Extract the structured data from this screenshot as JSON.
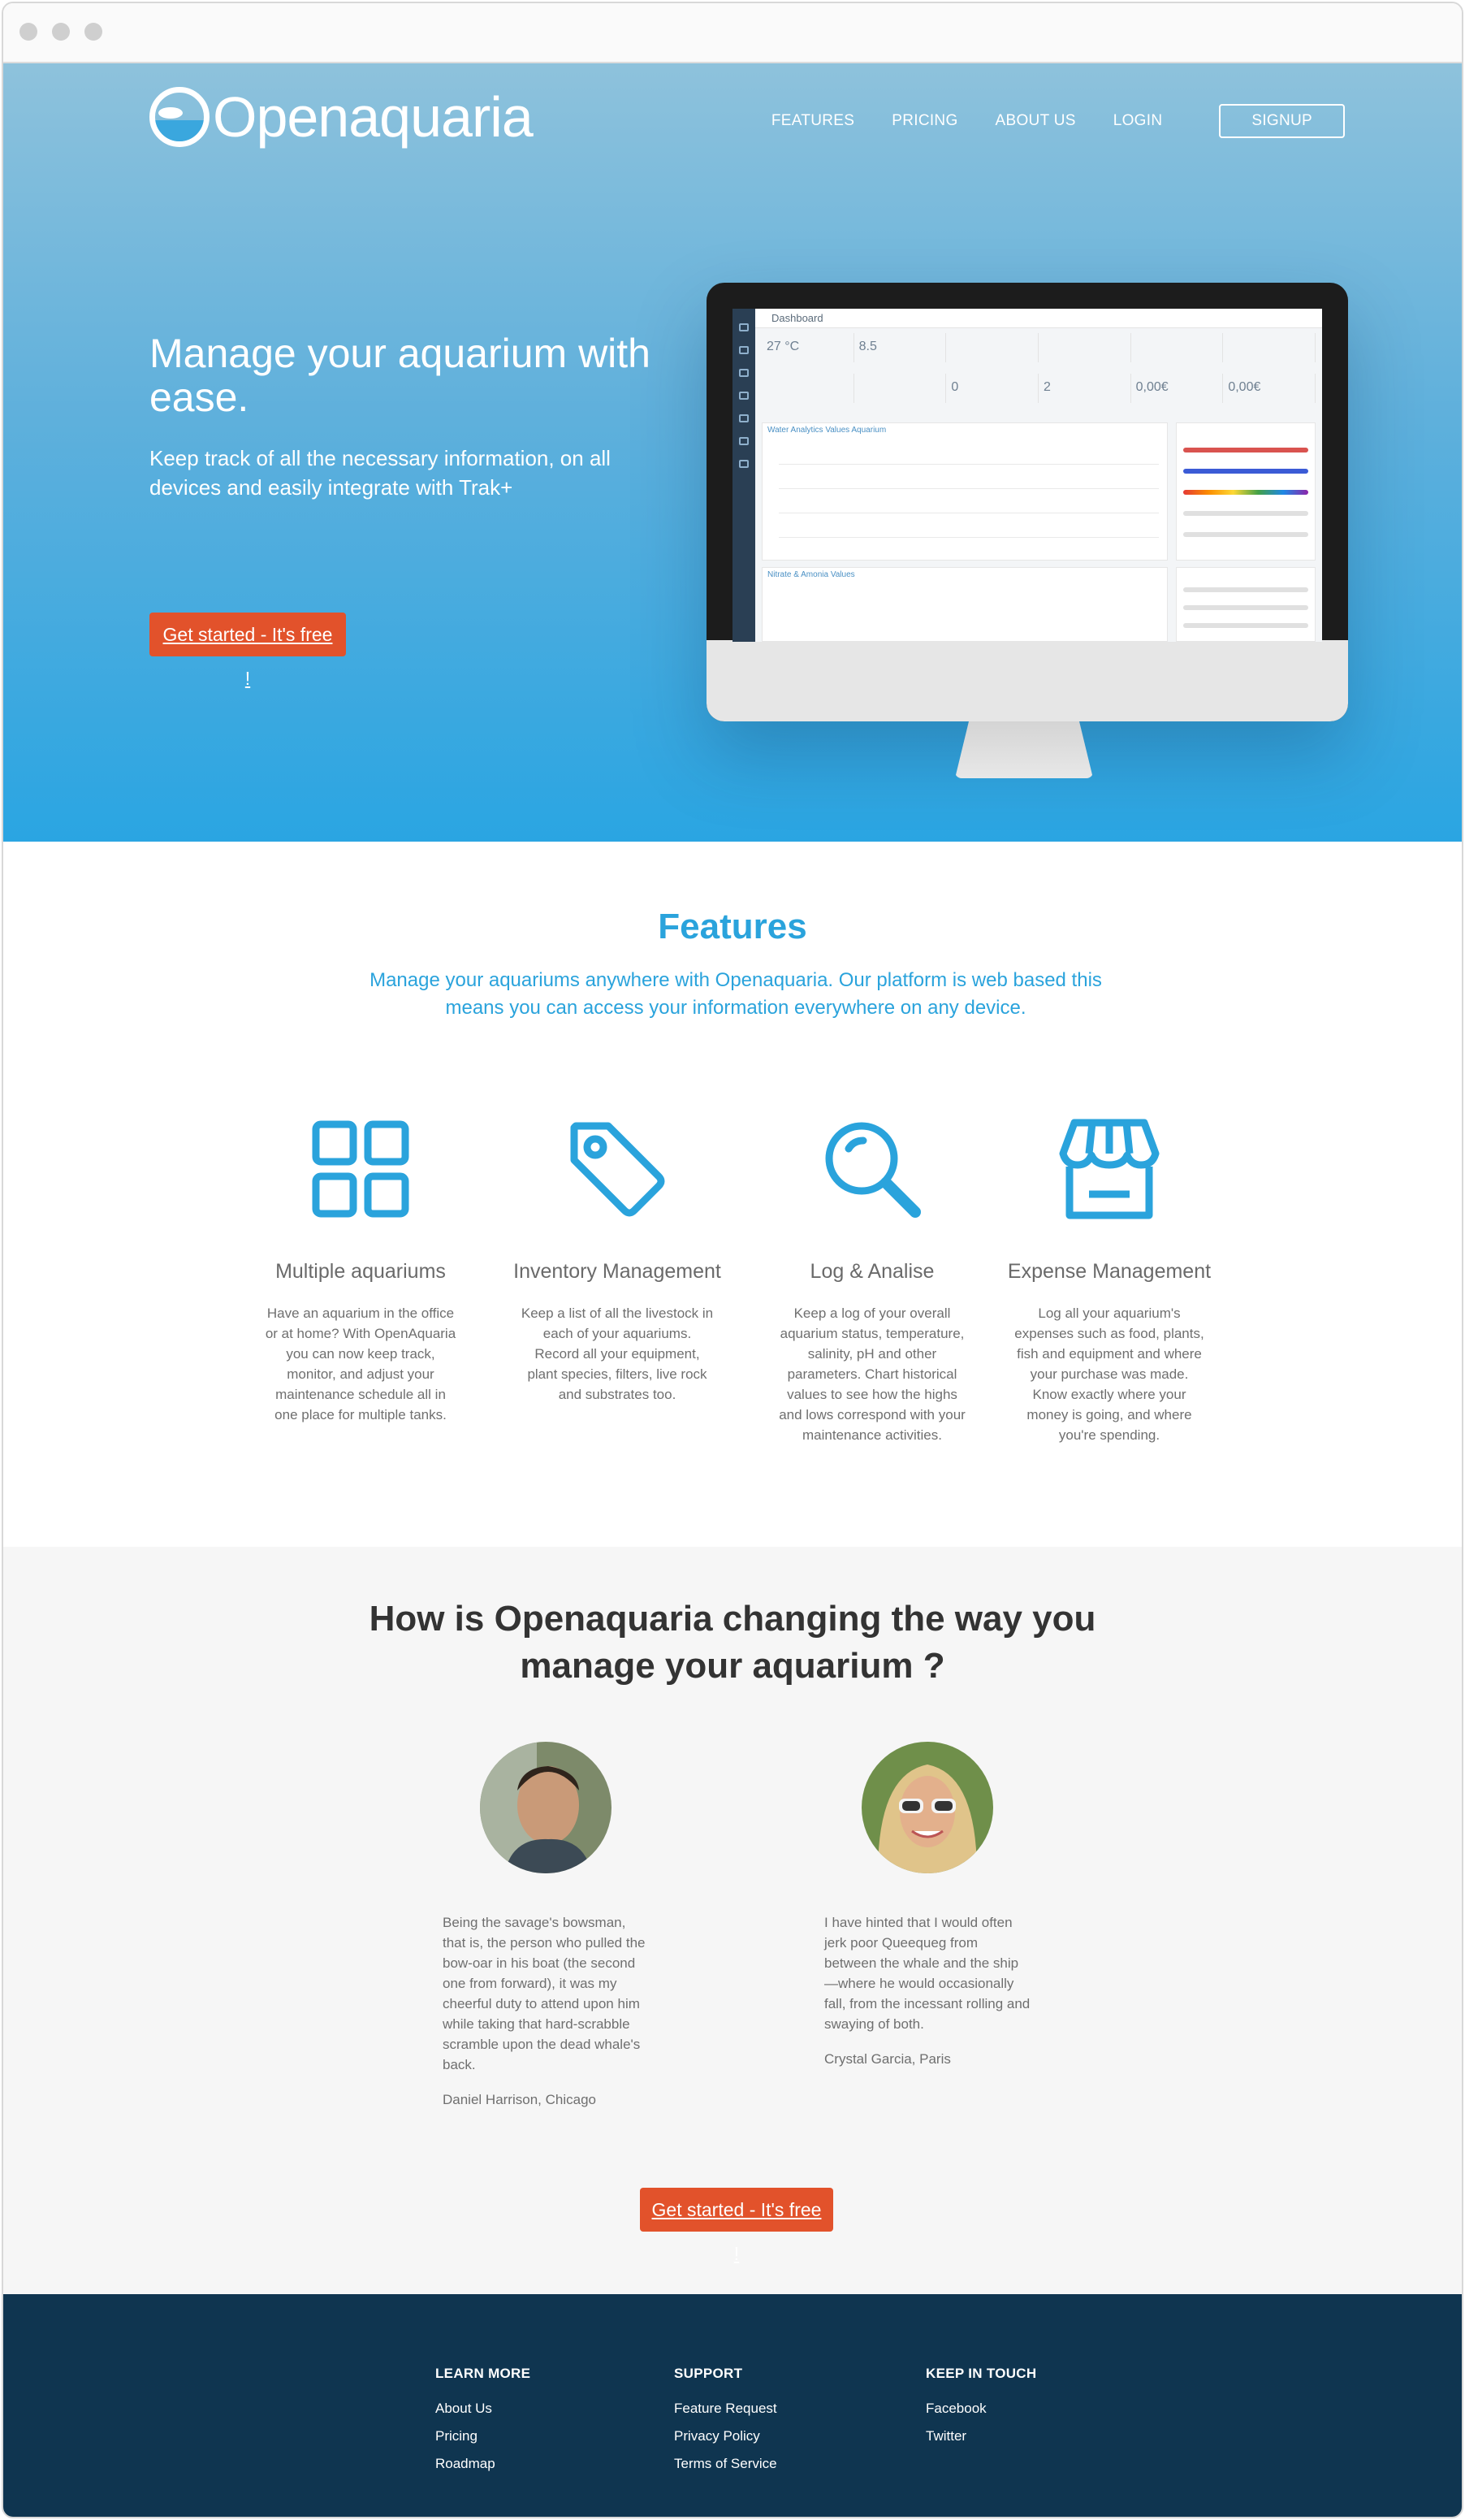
{
  "brand": {
    "name": "Openaquaria"
  },
  "nav": {
    "features": "FEATURES",
    "pricing": "PRICING",
    "about": "ABOUT US",
    "login": "LOGIN",
    "signup": "SIGNUP"
  },
  "hero": {
    "title": "Manage your aquarium with ease.",
    "subtitle": "Keep track of all the necessary information, on all devices and easily integrate with Trak+",
    "cta": "Get started - It's free !"
  },
  "dashboard": {
    "title": "Dashboard",
    "stats": [
      "27 °C",
      "8.5",
      "",
      "",
      "",
      "",
      "",
      "",
      "0",
      "2",
      "0,00€",
      "0,00€"
    ],
    "panel1": "Water Analytics Values Aquarium",
    "panel2": "Nitrate & Amonia Values"
  },
  "features": {
    "title": "Features",
    "subtitle": "Manage your aquariums anywhere with Openaquaria. Our platform is web based this means you can access your information everywhere on any device.",
    "items": [
      {
        "title": "Multiple aquariums",
        "text": "Have an aquarium in the office or at home? With OpenAquaria you can now keep track, monitor, and adjust your maintenance schedule all in one place for multiple tanks.",
        "icon": "grid-icon"
      },
      {
        "title": "Inventory Management",
        "text": "Keep a list of all the livestock in each of your aquariums. Record all your equipment, plant species, filters, live rock and substrates too.",
        "icon": "tag-icon"
      },
      {
        "title": "Log & Analise",
        "text": "Keep a log of your overall aquarium status, temperature, salinity, pH and other parameters. Chart historical values to see how the highs and lows correspond with your maintenance activities.",
        "icon": "magnifier-icon"
      },
      {
        "title": "Expense Management",
        "text": "Log all your aquarium's expenses such as food, plants, fish and equipment and where your purchase was made. Know exactly where your money is going, and where you're spending.",
        "icon": "store-icon"
      }
    ]
  },
  "testimonials": {
    "title": "How is Openaquaria changing the way you manage your aquarium ?",
    "items": [
      {
        "quote": "Being the savage's bowsman, that is, the person who pulled the bow-oar in his boat (the second one from forward), it was my cheerful duty to attend upon him while taking that hard-scrabble scramble upon the dead whale's back.",
        "author": "Daniel Harrison, Chicago"
      },
      {
        "quote": "I have hinted that I would often jerk poor Queequeg from between the whale and the ship—where he would occasionally fall, from the incessant rolling and swaying of both.",
        "author": "Crystal Garcia, Paris"
      }
    ],
    "cta": "Get started - It's free !"
  },
  "footer": {
    "learn": {
      "title": "LEARN MORE",
      "links": [
        "About Us",
        "Pricing",
        "Roadmap"
      ]
    },
    "support": {
      "title": "SUPPORT",
      "links": [
        "Feature Request",
        "Privacy Policy",
        "Terms of Service"
      ]
    },
    "touch": {
      "title": "KEEP IN TOUCH",
      "links": [
        "Facebook",
        "Twitter"
      ]
    }
  },
  "colors": {
    "accent": "#2aa3dc",
    "cta": "#e2522b",
    "footer": "#0f3550"
  }
}
